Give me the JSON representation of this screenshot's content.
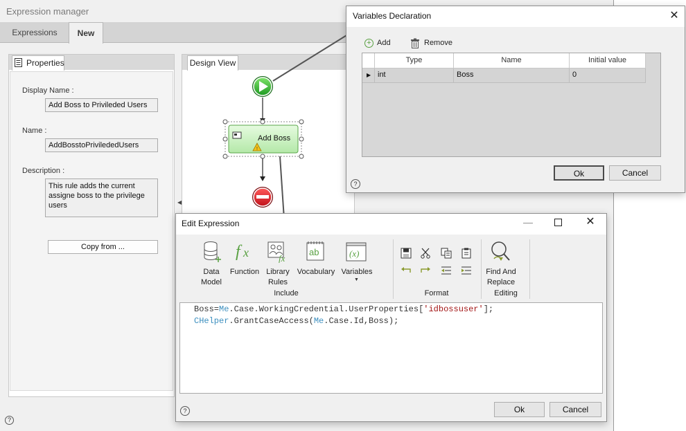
{
  "expression_manager": {
    "title": "Expression manager",
    "tabs": [
      {
        "label": "Expressions",
        "active": false
      },
      {
        "label": "New",
        "active": true
      }
    ],
    "properties_tab": "Properties",
    "design_view_tab": "Design View",
    "display_name_label": "Display Name :",
    "display_name_value": "Add Boss to Privileded Users",
    "name_label": "Name :",
    "name_value": "AddBosstoPrivilededUsers",
    "description_label": "Description :",
    "description_value": "This rule adds the current assigne boss to the privilege users",
    "copy_from_button": "Copy from ...",
    "flow": {
      "activity_label": "Add Boss",
      "start_icon": "start-play-icon",
      "end_icon": "stop-icon"
    }
  },
  "variables_declaration": {
    "title": "Variables Declaration",
    "toolbar": {
      "add_label": "Add",
      "remove_label": "Remove"
    },
    "columns": [
      "Type",
      "Name",
      "Initial value"
    ],
    "rows": [
      {
        "type": "int",
        "name": "Boss",
        "initial_value": "0"
      }
    ],
    "ok_label": "Ok",
    "cancel_label": "Cancel"
  },
  "edit_expression": {
    "title": "Edit Expression",
    "ribbon": {
      "include_group": "Include",
      "format_group": "Format",
      "editing_group": "Editing",
      "buttons": {
        "data_model": "Data Model",
        "function": "Function",
        "library_rules": "Library Rules",
        "vocabulary": "Vocabulary",
        "variables": "Variables",
        "find_and_replace": "Find And Replace"
      }
    },
    "code": {
      "line1": {
        "var": "Boss=",
        "me": "Me",
        "rest": ".Case.WorkingCredential.UserProperties[",
        "str": "'idbossuser'",
        "end": "];"
      },
      "line2": {
        "helper": "CHelper",
        "call": ".GrantCaseAccess(",
        "me": "Me",
        "rest": ".Case.Id,Boss);"
      }
    },
    "ok_label": "Ok",
    "cancel_label": "Cancel"
  },
  "colors": {
    "accent_green": "#58a041",
    "code_keyword": "#3c8fbf",
    "code_string": "#a31515",
    "activity_fill": "#c6f0c0",
    "stop_red": "#d9262d"
  }
}
